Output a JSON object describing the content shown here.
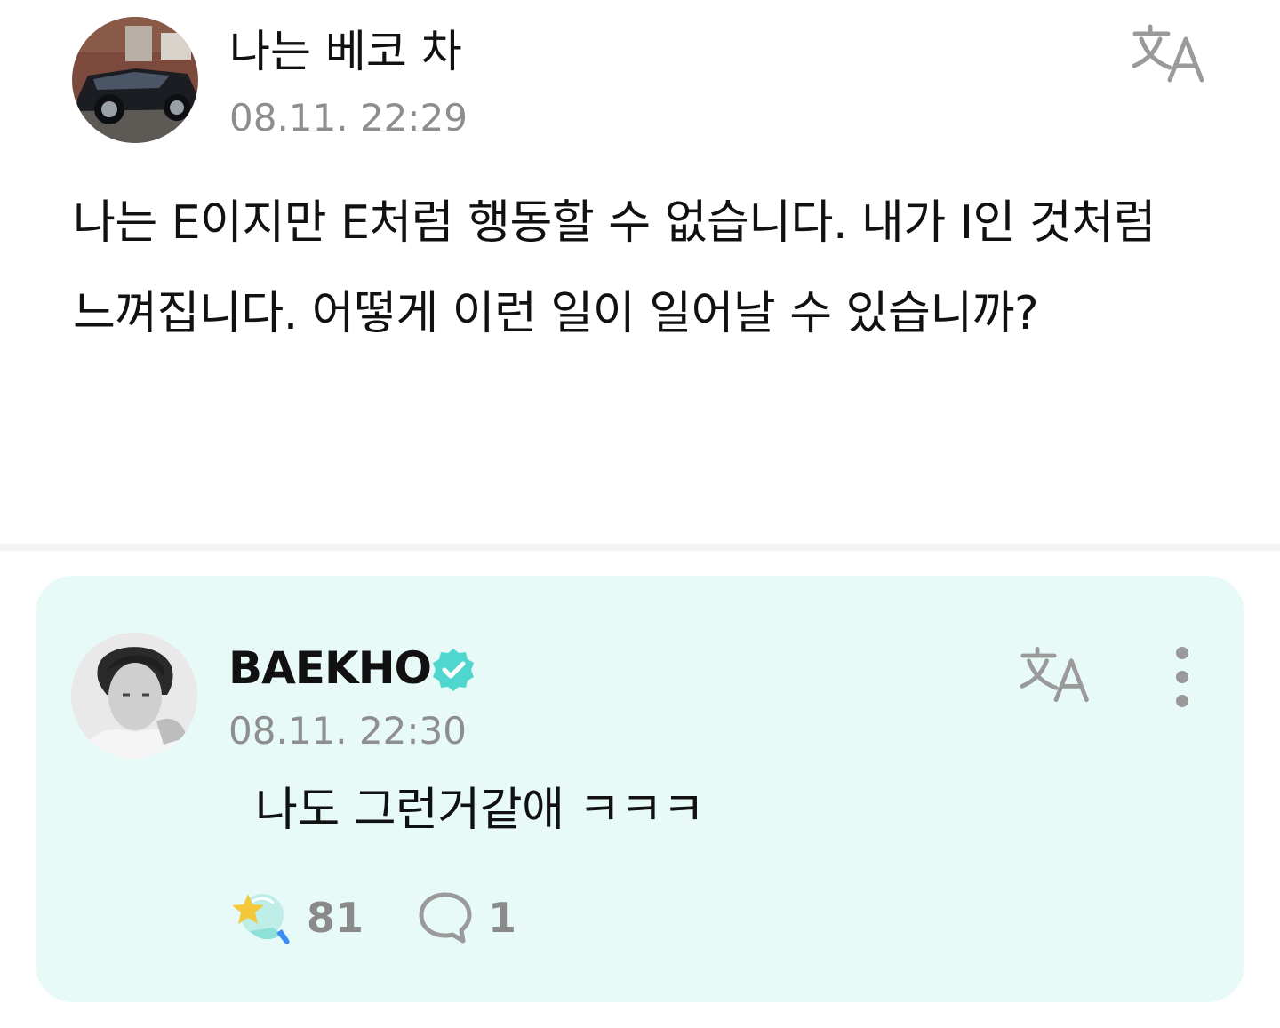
{
  "post": {
    "author": "나는 베코 차",
    "time": "08.11. 22:29",
    "body": "나는 E이지만 E처럼 행동할 수 없습니다. 내가 I인 것처럼 느껴집니다. 어떻게 이런 일이 일어날 수 있습니까?"
  },
  "reply": {
    "author": "BAEKHO",
    "verified": true,
    "time": "08.11. 22:30",
    "body": "나도 그런거같애 ㅋㅋㅋ",
    "likes": "81",
    "comments": "1"
  },
  "icons": {
    "translate": "translate-icon",
    "verified": "verified-badge-icon",
    "more": "more-vertical-icon",
    "like": "star-bubble-like-icon",
    "comment": "speech-bubble-icon"
  },
  "colors": {
    "accent": "#4fd6cf",
    "reply_background": "#e7faf7",
    "muted_text": "#8e8e8e",
    "like_star": "#f3c93b",
    "like_handle": "#3a8df2"
  }
}
